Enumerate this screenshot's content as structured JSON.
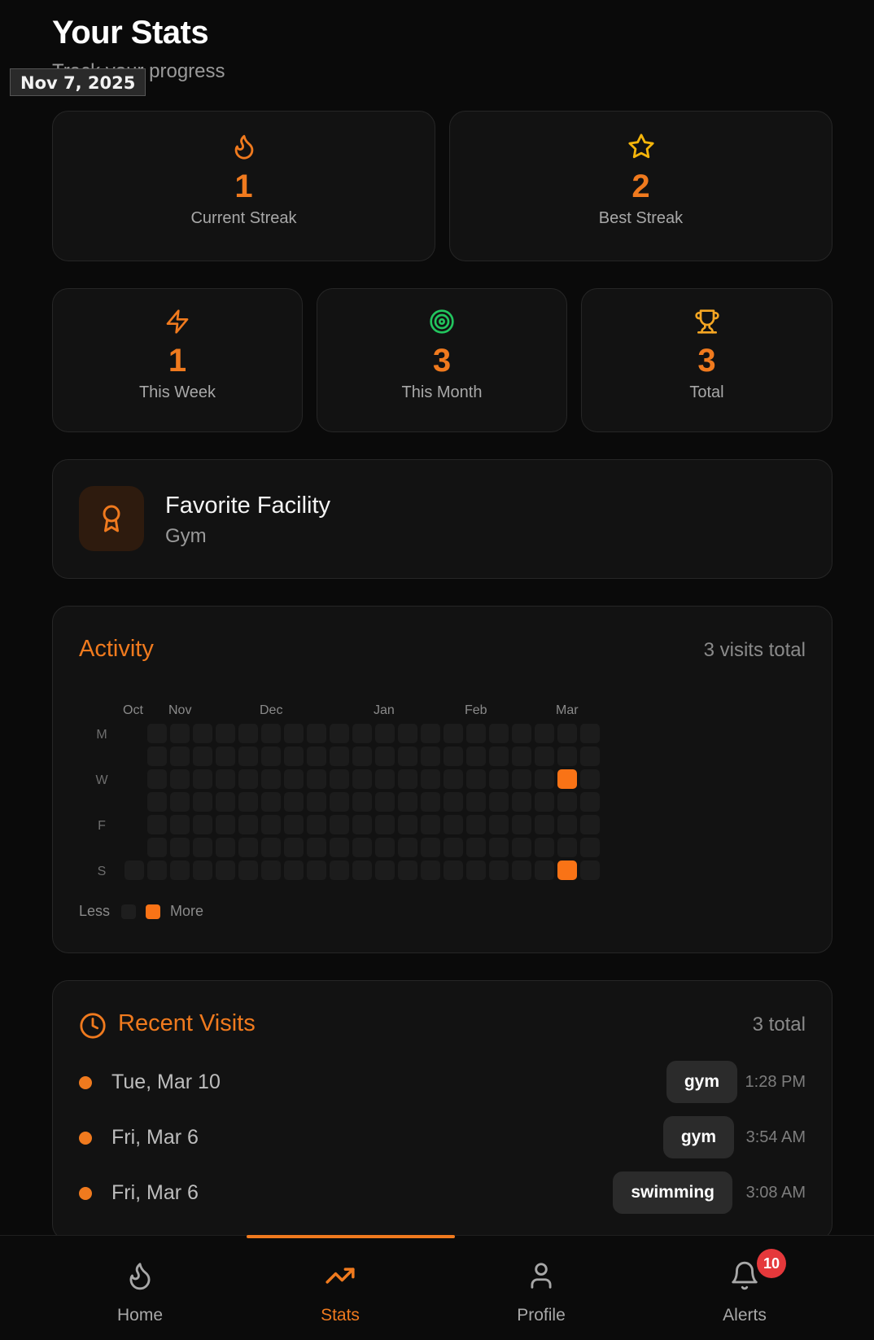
{
  "header": {
    "title": "Your Stats",
    "subtitle": "Track your progress",
    "date_tag": "Nov 7, 2025"
  },
  "stats": {
    "current_streak": {
      "value": "1",
      "label": "Current Streak",
      "icon": "flame-icon"
    },
    "best_streak": {
      "value": "2",
      "label": "Best Streak",
      "icon": "star-icon"
    },
    "this_week": {
      "value": "1",
      "label": "This Week",
      "icon": "zap-icon"
    },
    "this_month": {
      "value": "3",
      "label": "This Month",
      "icon": "target-icon"
    },
    "total": {
      "value": "3",
      "label": "Total",
      "icon": "trophy-icon"
    }
  },
  "favorite": {
    "title": "Favorite Facility",
    "value": "Gym",
    "icon": "award-icon"
  },
  "activity": {
    "title": "Activity",
    "meta": "3 visits total",
    "months": [
      "Oct",
      "Nov",
      "Dec",
      "Jan",
      "Feb",
      "Mar"
    ],
    "day_labels": [
      "M",
      "",
      "W",
      "",
      "F",
      "",
      "S"
    ],
    "legend_less": "Less",
    "legend_more": "More",
    "active_cells": [
      {
        "week": 19,
        "day": 2
      },
      {
        "week": 19,
        "day": 6
      }
    ]
  },
  "recent": {
    "title": "Recent Visits",
    "meta": "3 total",
    "icon": "clock-icon",
    "visits": [
      {
        "date": "Tue, Mar 10",
        "facility": "gym",
        "time": "1:28 PM"
      },
      {
        "date": "Fri, Mar 6",
        "facility": "gym",
        "time": "3:54 AM"
      },
      {
        "date": "Fri, Mar 6",
        "facility": "swimming",
        "time": "3:08 AM"
      }
    ]
  },
  "nav": {
    "items": [
      {
        "label": "Home",
        "icon": "flame-icon"
      },
      {
        "label": "Stats",
        "icon": "trending-up-icon"
      },
      {
        "label": "Profile",
        "icon": "user-icon"
      },
      {
        "label": "Alerts",
        "icon": "bell-icon"
      }
    ],
    "active": "Stats",
    "alerts_badge": "10"
  },
  "colors": {
    "accent": "#f07a1e",
    "green": "#22c55e",
    "gold": "#f5b50a",
    "badge_red": "#e5383b"
  }
}
